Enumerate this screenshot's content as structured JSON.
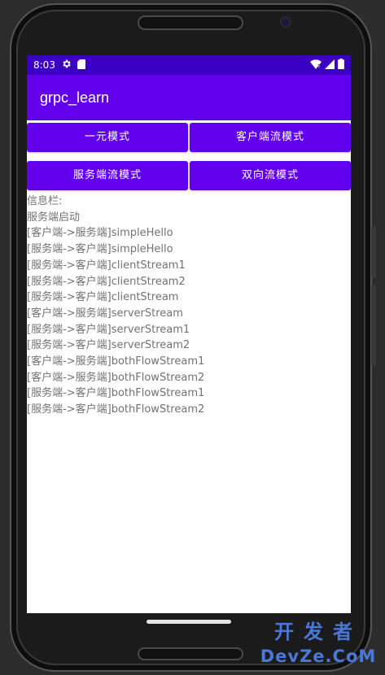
{
  "status_bar": {
    "time": "8:03",
    "icons": [
      "gear-icon",
      "sd-card-icon",
      "wifi-icon",
      "signal-icon",
      "battery-icon"
    ]
  },
  "app_bar": {
    "title": "grpc_learn"
  },
  "buttons": {
    "unary": "一元模式",
    "client_stream": "客户端流模式",
    "server_stream": "服务端流模式",
    "bidi_stream": "双向流模式"
  },
  "log": {
    "header": "信息栏:",
    "lines": [
      "服务端启动",
      "[客户端->服务端]simpleHello",
      "[服务端->客户端]simpleHello",
      "[服务端->客户端]clientStream1",
      "[服务端->客户端]clientStream2",
      "[服务端->客户端]clientStream",
      "[客户端->服务端]serverStream",
      "[服务端->客户端]serverStream1",
      "[服务端->客户端]serverStream2",
      "[客户端->服务端]bothFlowStream1",
      "[客户端->服务端]bothFlowStream2",
      "[服务端->客户端]bothFlowStream1",
      "[服务端->客户端]bothFlowStream2"
    ]
  },
  "watermark": {
    "line1": "开发者",
    "line2": "DevZe.CoM"
  },
  "colors": {
    "primary": "#6200ee",
    "status_bar": "#3b00c2",
    "log_text": "#727272",
    "watermark": "#4a78d8"
  }
}
